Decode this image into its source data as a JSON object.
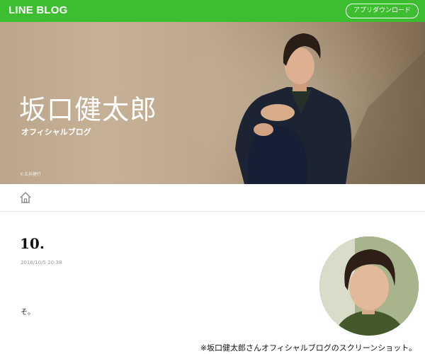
{
  "header": {
    "logo": "LINE BLOG",
    "app_download_label": "アプリダウンロード",
    "brand_color": "#3dbd30"
  },
  "hero": {
    "title": "坂口健太郎",
    "subtitle": "オフィシャルブログ",
    "photo_credit": "©五井健行"
  },
  "nav": {
    "home_icon": "home-icon"
  },
  "post": {
    "title": "10.",
    "date": "2016/10/5 20:38",
    "body": "そ。"
  },
  "caption": "※坂口健太郎さんオフィシャルブログのスクリーンショット。"
}
